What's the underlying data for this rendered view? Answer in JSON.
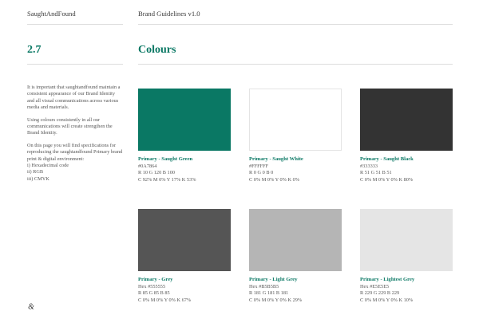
{
  "header": {
    "brand": "SaughtAndFound",
    "doc_title": "Brand Guidelines v1.0"
  },
  "section": {
    "number": "2.7",
    "title": "Colours"
  },
  "intro": {
    "paragraphs": [
      "It is important that saughtandfound maintain a consistent appearance of our Brand Identity and all visual communications across various media and materials.",
      "Using colours consistently in all our communications will create strengthen the Brand Identity."
    ],
    "spec_lead": "On this page you will find specifications for reproducing the saughtandfound Primary brand print & digital environment:",
    "spec_items": [
      "i) Hexadecimal code",
      "ii) RGB",
      "iii) CMYK"
    ]
  },
  "colors": [
    {
      "name": "Primary - Saught Green",
      "hex": "#0A7864",
      "rgb": "R 10   G 120   B 100",
      "cmyk": "C 92%   M 0%   Y 17%   K 53%",
      "swatch": "#0A7864"
    },
    {
      "name": "Primary - Saught White",
      "hex": "#FFFFFF",
      "rgb": "R 0   G 0   B 0",
      "cmyk": "C 0%   M 0%   Y 0%   K 0%",
      "swatch": "#FFFFFF"
    },
    {
      "name": "Primary - Saught Black",
      "hex": "#333333",
      "rgb": "R 51   G 51   B 51",
      "cmyk": "C 0%   M 0%   Y 0%   K 80%",
      "swatch": "#333333"
    },
    {
      "name": "Primary - Grey",
      "hex": "Hex #555555",
      "rgb": "R 85   G 85   B 85",
      "cmyk": "C 0%   M 0%   Y 0%   K 67%",
      "swatch": "#555555"
    },
    {
      "name": "Primary - Light Grey",
      "hex": "Hex #B5B5B5",
      "rgb": "R 181   G 181   B 181",
      "cmyk": "C 0%   M 0%   Y 0%   K 29%",
      "swatch": "#B5B5B5"
    },
    {
      "name": "Primary - Lightest Grey",
      "hex": "Hex #E5E5E5",
      "rgb": "R 229   G 229   B 229",
      "cmyk": "C 0%   M 0%   Y 0%   K 10%",
      "swatch": "#E5E5E5"
    }
  ],
  "footer": {
    "icon": "ampersand-logo-icon",
    "glyph": "&"
  }
}
